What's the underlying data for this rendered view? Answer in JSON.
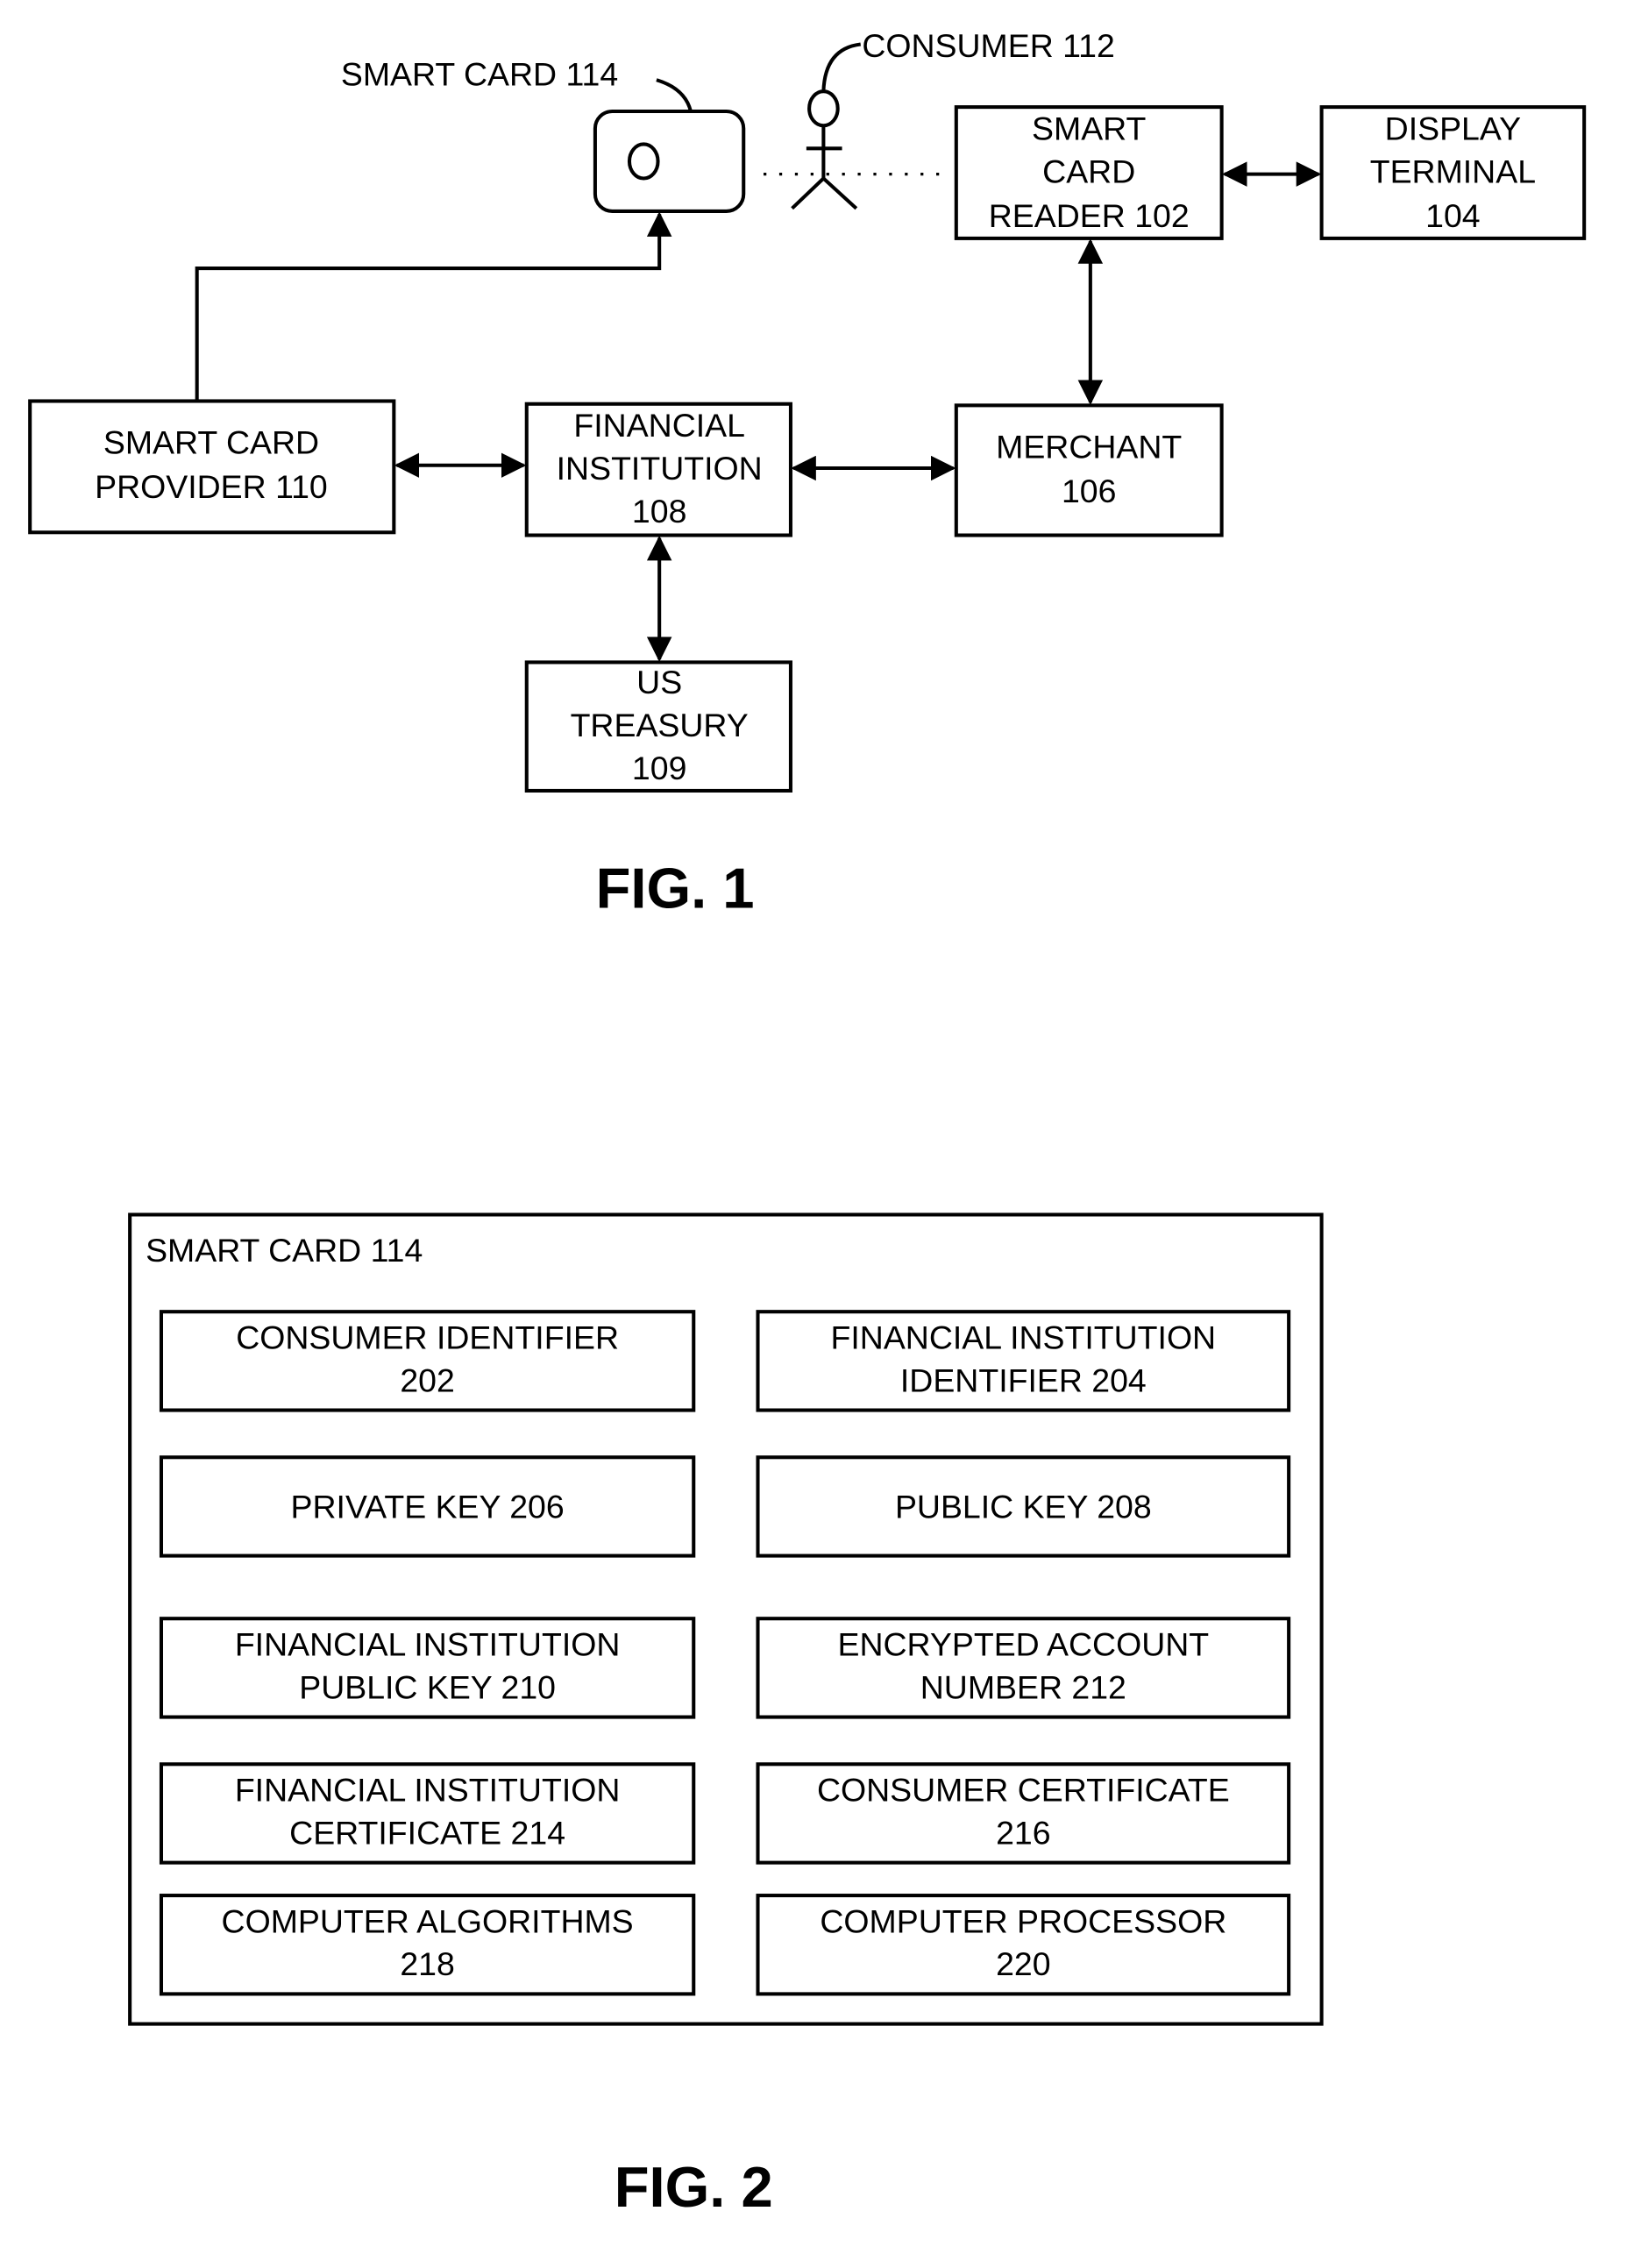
{
  "fig1": {
    "caption": "FIG. 1",
    "smart_card_label": "SMART CARD 114",
    "consumer_label": "CONSUMER 112",
    "reader": [
      "SMART",
      "CARD",
      "READER 102"
    ],
    "display": [
      "DISPLAY",
      "TERMINAL",
      "104"
    ],
    "provider": [
      "SMART CARD",
      "PROVIDER 110"
    ],
    "financial": [
      "FINANCIAL",
      "INSTITUTION",
      "108"
    ],
    "merchant": [
      "MERCHANT",
      "106"
    ],
    "treasury": [
      "US",
      "TREASURY",
      "109"
    ]
  },
  "fig2": {
    "caption": "FIG. 2",
    "container_label": "SMART CARD 114",
    "boxes": [
      [
        "CONSUMER IDENTIFIER",
        "202"
      ],
      [
        "FINANCIAL INSTITUTION",
        "IDENTIFIER 204"
      ],
      [
        "PRIVATE KEY 206"
      ],
      [
        "PUBLIC KEY 208"
      ],
      [
        "FINANCIAL INSTITUTION",
        "PUBLIC KEY 210"
      ],
      [
        "ENCRYPTED ACCOUNT",
        "NUMBER 212"
      ],
      [
        "FINANCIAL INSTITUTION",
        "CERTIFICATE 214"
      ],
      [
        "CONSUMER CERTIFICATE",
        "216"
      ],
      [
        "COMPUTER ALGORITHMS",
        "218"
      ],
      [
        "COMPUTER PROCESSOR",
        "220"
      ]
    ]
  }
}
